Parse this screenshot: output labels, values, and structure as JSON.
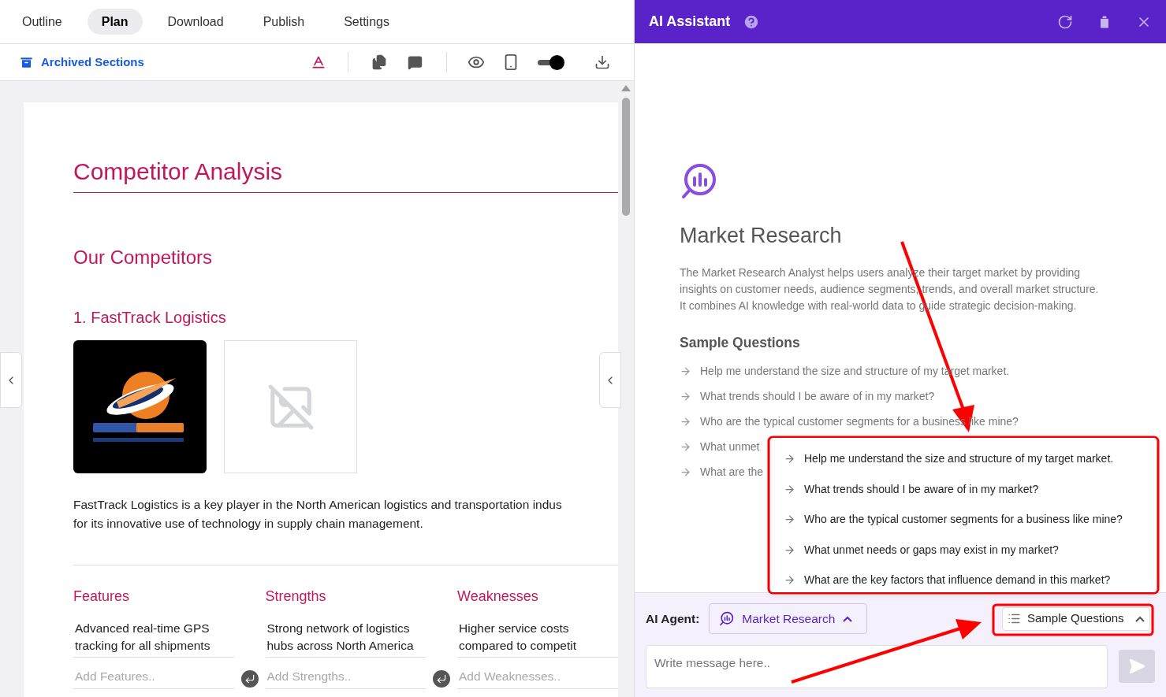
{
  "tabs": [
    {
      "label": "Outline",
      "selected": false
    },
    {
      "label": "Plan",
      "selected": true
    },
    {
      "label": "Download",
      "selected": false
    },
    {
      "label": "Publish",
      "selected": false
    },
    {
      "label": "Settings",
      "selected": false
    }
  ],
  "toolbar": {
    "archived_label": "Archived Sections",
    "preview_toggle": {
      "on": true
    }
  },
  "document": {
    "title": "Competitor Analysis",
    "section": "Our Competitors",
    "competitor": "1. FastTrack Logistics",
    "logo": {
      "kind": "picture"
    },
    "description_lines": [
      "FastTrack Logistics is a key player in the North American logistics and transportation indus",
      "for its innovative use of technology in supply chain management."
    ],
    "columns": [
      {
        "heading": "Features",
        "item_lines": [
          "Advanced real-time GPS",
          "tracking for all shipments"
        ],
        "placeholder": "Add Features.."
      },
      {
        "heading": "Strengths",
        "item_lines": [
          "Strong network of logistics",
          "hubs across North America"
        ],
        "placeholder": "Add Strengths.."
      },
      {
        "heading": "Weaknesses",
        "item_lines": [
          "Higher service costs",
          "compared to competit"
        ],
        "placeholder": "Add Weaknesses.."
      }
    ]
  },
  "assistant": {
    "title": "AI Assistant",
    "agent_title": "Market Research",
    "agent_description_lines": [
      "The Market Research Analyst helps users analyze their target market by providing",
      "insights on customer needs, audience segments, trends, and overall market structure.",
      "It combines AI knowledge with real-world data to guide strategic decision-making."
    ],
    "sample_heading": "Sample Questions",
    "questions": [
      "Help me understand the size and structure of my target market.",
      "What trends should I be aware of in my market?",
      "Who are the typical customer segments for a business like mine?",
      "What unmet",
      "What are the"
    ],
    "menu": {
      "open": true,
      "items": [
        "Help me understand the size and structure of my target market.",
        "What trends should I be aware of in my market?",
        "Who are the typical customer segments for a business like mine?",
        "What unmet needs or gaps may exist in my market?",
        "What are the key factors that influence demand in this market?"
      ]
    },
    "agent_label": "AI Agent:",
    "agent": "Market Research",
    "sample_button": "Sample Questions",
    "message_placeholder": "Write message here.."
  }
}
